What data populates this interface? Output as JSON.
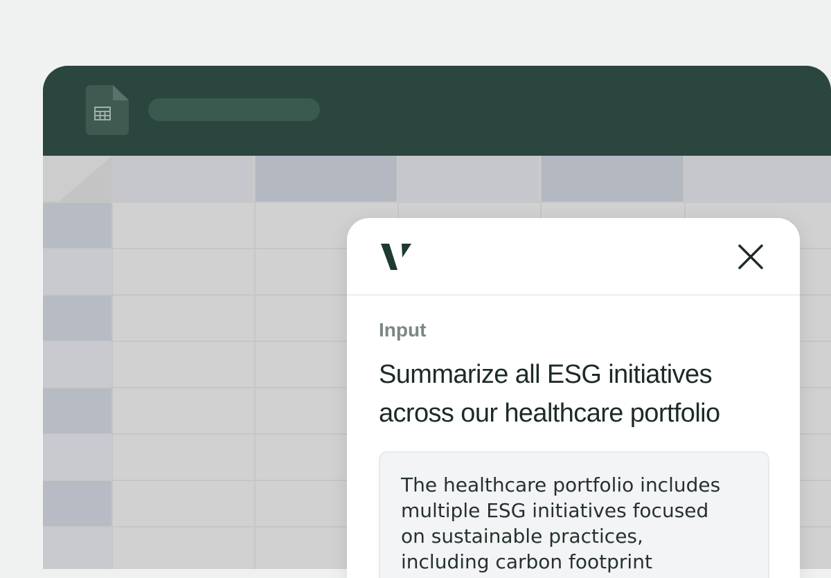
{
  "icons": {
    "spreadsheet_file": "spreadsheet-file-icon",
    "brand_logo": "brand-v-logo",
    "close": "close-icon"
  },
  "colors": {
    "titlebar": "#2b463e",
    "panel_bg": "#ffffff",
    "prompt_text": "#1d2b27",
    "label_text": "#7b8784"
  },
  "panel": {
    "input_label": "Input",
    "prompt_line1": "Summarize all ESG initiatives",
    "prompt_line2": "across our healthcare portfolio",
    "response": {
      "line1": "The healthcare portfolio includes",
      "line2": "multiple ESG initiatives focused",
      "line3": "on sustainable practices,",
      "line4": "including carbon footprint"
    }
  }
}
